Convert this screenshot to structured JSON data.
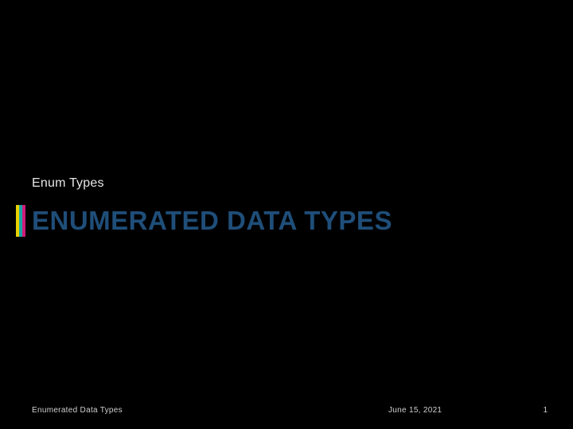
{
  "slide": {
    "subtitle": "Enum Types",
    "title": "ENUMERATED DATA TYPES"
  },
  "footer": {
    "left": "Enumerated Data Types",
    "date": "June 15, 2021",
    "page": "1"
  },
  "accent_colors": {
    "bar1": "#e6d200",
    "bar2": "#1aa3a3",
    "bar3": "#d11a7a"
  }
}
